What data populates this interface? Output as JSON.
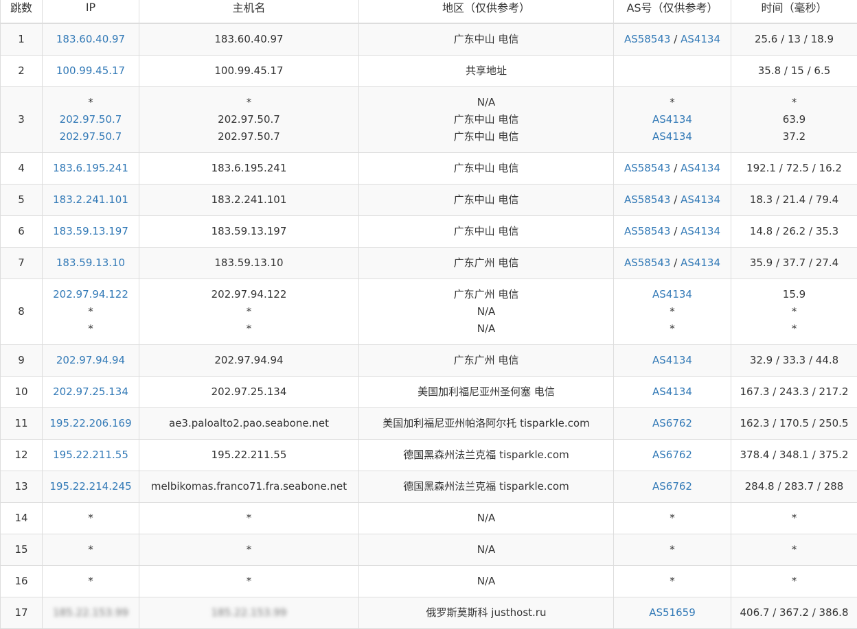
{
  "table": {
    "headers": [
      "跳数",
      "IP",
      "主机名",
      "地区（仅供参考）",
      "AS号（仅供参考）",
      "时间（毫秒）"
    ],
    "rows": [
      {
        "hop": "1",
        "ip": [
          "183.60.40.97"
        ],
        "host": [
          "183.60.40.97"
        ],
        "region": [
          "广东中山 电信"
        ],
        "as": [
          [
            "AS58543",
            "AS4134"
          ]
        ],
        "time": [
          "25.6 / 13 / 18.9"
        ]
      },
      {
        "hop": "2",
        "ip": [
          "100.99.45.17"
        ],
        "host": [
          "100.99.45.17"
        ],
        "region": [
          "共享地址"
        ],
        "as": [
          []
        ],
        "time": [
          "35.8 / 15 / 6.5"
        ]
      },
      {
        "hop": "3",
        "ip": [
          "*",
          "202.97.50.7",
          "202.97.50.7"
        ],
        "host": [
          "*",
          "202.97.50.7",
          "202.97.50.7"
        ],
        "region": [
          "N/A",
          "广东中山 电信",
          "广东中山 电信"
        ],
        "as": [
          [
            "*"
          ],
          [
            "AS4134"
          ],
          [
            "AS4134"
          ]
        ],
        "time": [
          "*",
          "63.9",
          "37.2"
        ]
      },
      {
        "hop": "4",
        "ip": [
          "183.6.195.241"
        ],
        "host": [
          "183.6.195.241"
        ],
        "region": [
          "广东中山 电信"
        ],
        "as": [
          [
            "AS58543",
            "AS4134"
          ]
        ],
        "time": [
          "192.1 / 72.5 / 16.2"
        ]
      },
      {
        "hop": "5",
        "ip": [
          "183.2.241.101"
        ],
        "host": [
          "183.2.241.101"
        ],
        "region": [
          "广东中山 电信"
        ],
        "as": [
          [
            "AS58543",
            "AS4134"
          ]
        ],
        "time": [
          "18.3 / 21.4 / 79.4"
        ]
      },
      {
        "hop": "6",
        "ip": [
          "183.59.13.197"
        ],
        "host": [
          "183.59.13.197"
        ],
        "region": [
          "广东中山 电信"
        ],
        "as": [
          [
            "AS58543",
            "AS4134"
          ]
        ],
        "time": [
          "14.8 / 26.2 / 35.3"
        ]
      },
      {
        "hop": "7",
        "ip": [
          "183.59.13.10"
        ],
        "host": [
          "183.59.13.10"
        ],
        "region": [
          "广东广州 电信"
        ],
        "as": [
          [
            "AS58543",
            "AS4134"
          ]
        ],
        "time": [
          "35.9 / 37.7 / 27.4"
        ]
      },
      {
        "hop": "8",
        "ip": [
          "202.97.94.122",
          "*",
          "*"
        ],
        "host": [
          "202.97.94.122",
          "*",
          "*"
        ],
        "region": [
          "广东广州 电信",
          "N/A",
          "N/A"
        ],
        "as": [
          [
            "AS4134"
          ],
          [
            "*"
          ],
          [
            "*"
          ]
        ],
        "time": [
          "15.9",
          "*",
          "*"
        ]
      },
      {
        "hop": "9",
        "ip": [
          "202.97.94.94"
        ],
        "host": [
          "202.97.94.94"
        ],
        "region": [
          "广东广州 电信"
        ],
        "as": [
          [
            "AS4134"
          ]
        ],
        "time": [
          "32.9 / 33.3 / 44.8"
        ]
      },
      {
        "hop": "10",
        "ip": [
          "202.97.25.134"
        ],
        "host": [
          "202.97.25.134"
        ],
        "region": [
          "美国加利福尼亚州圣何塞 电信"
        ],
        "as": [
          [
            "AS4134"
          ]
        ],
        "time": [
          "167.3 / 243.3 / 217.2"
        ]
      },
      {
        "hop": "11",
        "ip": [
          "195.22.206.169"
        ],
        "host": [
          "ae3.paloalto2.pao.seabone.net"
        ],
        "region": [
          "美国加利福尼亚州帕洛阿尔托 tisparkle.com"
        ],
        "as": [
          [
            "AS6762"
          ]
        ],
        "time": [
          "162.3 / 170.5 / 250.5"
        ]
      },
      {
        "hop": "12",
        "ip": [
          "195.22.211.55"
        ],
        "host": [
          "195.22.211.55"
        ],
        "region": [
          "德国黑森州法兰克福 tisparkle.com"
        ],
        "as": [
          [
            "AS6762"
          ]
        ],
        "time": [
          "378.4 / 348.1 / 375.2"
        ]
      },
      {
        "hop": "13",
        "ip": [
          "195.22.214.245"
        ],
        "host": [
          "melbikomas.franco71.fra.seabone.net"
        ],
        "region": [
          "德国黑森州法兰克福 tisparkle.com"
        ],
        "as": [
          [
            "AS6762"
          ]
        ],
        "time": [
          "284.8 / 283.7 / 288"
        ]
      },
      {
        "hop": "14",
        "ip": [
          "*"
        ],
        "host": [
          "*"
        ],
        "region": [
          "N/A"
        ],
        "as": [
          [
            "*"
          ]
        ],
        "time": [
          "*"
        ]
      },
      {
        "hop": "15",
        "ip": [
          "*"
        ],
        "host": [
          "*"
        ],
        "region": [
          "N/A"
        ],
        "as": [
          [
            "*"
          ]
        ],
        "time": [
          "*"
        ]
      },
      {
        "hop": "16",
        "ip": [
          "*"
        ],
        "host": [
          "*"
        ],
        "region": [
          "N/A"
        ],
        "as": [
          [
            "*"
          ]
        ],
        "time": [
          "*"
        ]
      },
      {
        "hop": "17",
        "ip": [
          "185.22.153.99"
        ],
        "host": [
          "185.22.153.99"
        ],
        "region": [
          "俄罗斯莫斯科 justhost.ru"
        ],
        "as": [
          [
            "AS51659"
          ]
        ],
        "time": [
          "406.7 / 367.2 / 386.8"
        ],
        "blurred": true
      }
    ]
  },
  "colors": {
    "link": "#337ab7",
    "text": "#333333",
    "border": "#dddddd",
    "stripe": "#f9f9f9"
  }
}
